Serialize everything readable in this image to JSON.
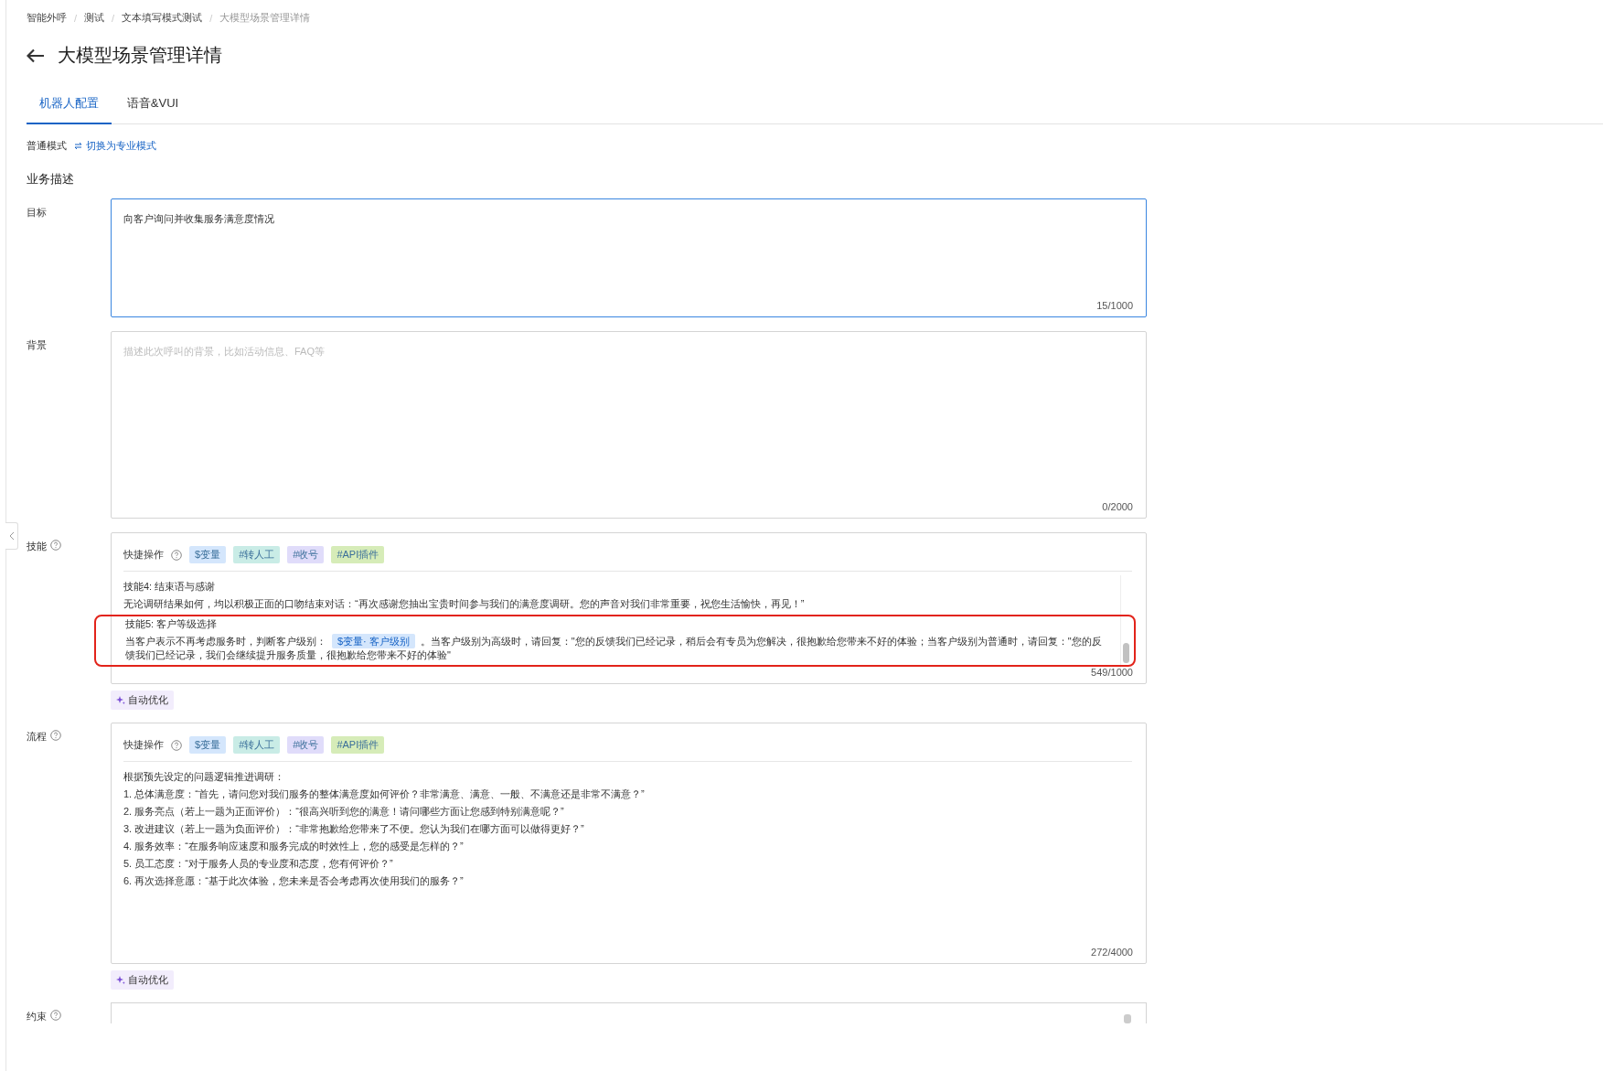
{
  "breadcrumb": [
    {
      "label": "智能外呼",
      "current": false
    },
    {
      "label": "测试",
      "current": false
    },
    {
      "label": "文本填写模式测试",
      "current": false
    },
    {
      "label": "大模型场景管理详情",
      "current": true
    }
  ],
  "breadcrumb_separator": "/",
  "title": "大模型场景管理详情",
  "tabs": [
    {
      "label": "机器人配置",
      "selected": true
    },
    {
      "label": "语音&VUI",
      "selected": false
    }
  ],
  "mode": {
    "label": "普通模式",
    "switch_link": "切换为专业模式"
  },
  "section_title": "业务描述",
  "fields": [
    {
      "kind": "text",
      "label": "目标",
      "value": "向客户询问并收集服务满意度情况",
      "counter": "15/1000",
      "focused": true
    },
    {
      "kind": "text",
      "label": "背景",
      "placeholder": "描述此次呼叫的背景，比如活动信息、FAQ等",
      "counter": "0/2000",
      "focused": false
    },
    {
      "kind": "rich",
      "label": "技能",
      "quick_label": "快捷操作",
      "chips": [
        {
          "label": "$变量",
          "color": "#d4e6fc"
        },
        {
          "label": "#转人工",
          "color": "#c9ece6"
        },
        {
          "label": "#收号",
          "color": "#e0dcfa"
        },
        {
          "label": "#API插件",
          "color": "#d6ecb8"
        }
      ],
      "lines": [
        {
          "highlighted": false,
          "parts": [
            {
              "kind": "text",
              "text": "技能4: 结束语与感谢"
            }
          ]
        },
        {
          "highlighted": false,
          "parts": [
            {
              "kind": "text",
              "text": "无论调研结果如何，均以积极正面的口吻结束对话：“再次感谢您抽出宝贵时间参与我们的满意度调研。您的声音对我们非常重要，祝您生活愉快，再见！”"
            }
          ]
        },
        {
          "highlighted": true,
          "parts": [
            {
              "kind": "text",
              "text": "技能5: 客户等级选择"
            }
          ]
        },
        {
          "highlighted": true,
          "parts": [
            {
              "kind": "text",
              "text": "当客户表示不再考虑服务时，判断客户级别："
            },
            {
              "kind": "variable",
              "text": "$变量· 客户级别"
            },
            {
              "kind": "text",
              "text": "。当客户级别为高级时，请回复：\"您的反馈我们已经记录，稍后会有专员为您解决，很抱歉给您带来不好的体验；当客户级别为普通时，请回复：\"您的反馈我们已经记录，我们会继续提升服务质量，很抱歉给您带来不好的体验\""
            }
          ]
        }
      ],
      "counter": "549/1000",
      "scrollable": true,
      "optimize": "自动优化"
    },
    {
      "kind": "rich",
      "label": "流程",
      "quick_label": "快捷操作",
      "chips": [
        {
          "label": "$变量",
          "color": "#d4e6fc"
        },
        {
          "label": "#转人工",
          "color": "#c9ece6"
        },
        {
          "label": "#收号",
          "color": "#e0dcfa"
        },
        {
          "label": "#API插件",
          "color": "#d6ecb8"
        }
      ],
      "lines": [
        {
          "highlighted": false,
          "parts": [
            {
              "kind": "text",
              "text": " 根据预先设定的问题逻辑推进调研："
            }
          ]
        },
        {
          "highlighted": false,
          "parts": [
            {
              "kind": "text",
              "text": "1. 总体满意度：“首先，请问您对我们服务的整体满意度如何评价？非常满意、满意、一般、不满意还是非常不满意？”"
            }
          ]
        },
        {
          "highlighted": false,
          "parts": [
            {
              "kind": "text",
              "text": "2. 服务亮点（若上一题为正面评价）：“很高兴听到您的满意！请问哪些方面让您感到特别满意呢？”"
            }
          ]
        },
        {
          "highlighted": false,
          "parts": [
            {
              "kind": "text",
              "text": "3. 改进建议（若上一题为负面评价）：“非常抱歉给您带来了不便。您认为我们在哪方面可以做得更好？”"
            }
          ]
        },
        {
          "highlighted": false,
          "parts": [
            {
              "kind": "text",
              "text": "4. 服务效率：“在服务响应速度和服务完成的时效性上，您的感受是怎样的？”"
            }
          ]
        },
        {
          "highlighted": false,
          "parts": [
            {
              "kind": "text",
              "text": "5. 员工态度：“对于服务人员的专业度和态度，您有何评价？”"
            }
          ]
        },
        {
          "highlighted": false,
          "parts": [
            {
              "kind": "text",
              "text": "6. 再次选择意愿：“基于此次体验，您未来是否会考虑再次使用我们的服务？”"
            }
          ]
        }
      ],
      "counter": "272/4000",
      "scrollable": false,
      "optimize": "自动优化"
    },
    {
      "kind": "cut",
      "label": "约束"
    }
  ]
}
